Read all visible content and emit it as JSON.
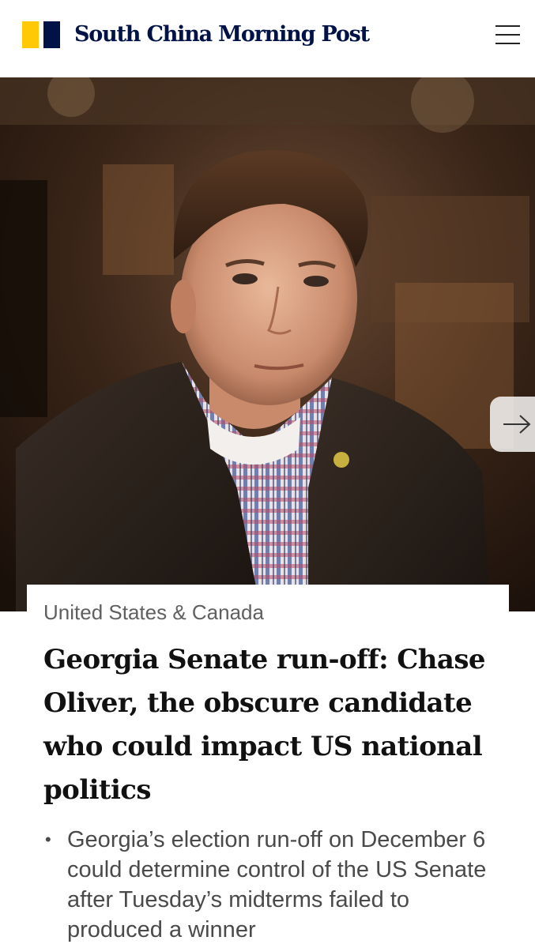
{
  "header": {
    "brand": "South China Morning Post",
    "brand_colors": {
      "yellow": "#FFCA05",
      "navy": "#001246"
    },
    "menu_icon": "hamburger-menu-icon"
  },
  "hero": {
    "image_subject": "photo",
    "next_icon": "arrow-right-icon"
  },
  "article": {
    "section": "United States & Canada",
    "headline": "Georgia Senate run-off: Chase Oliver, the obscure candidate who could impact US national politics",
    "summary": [
      "Georgia’s election run-off on December 6 could determine control of the US Senate after Tuesday’s midterms failed to produced a winner"
    ]
  }
}
